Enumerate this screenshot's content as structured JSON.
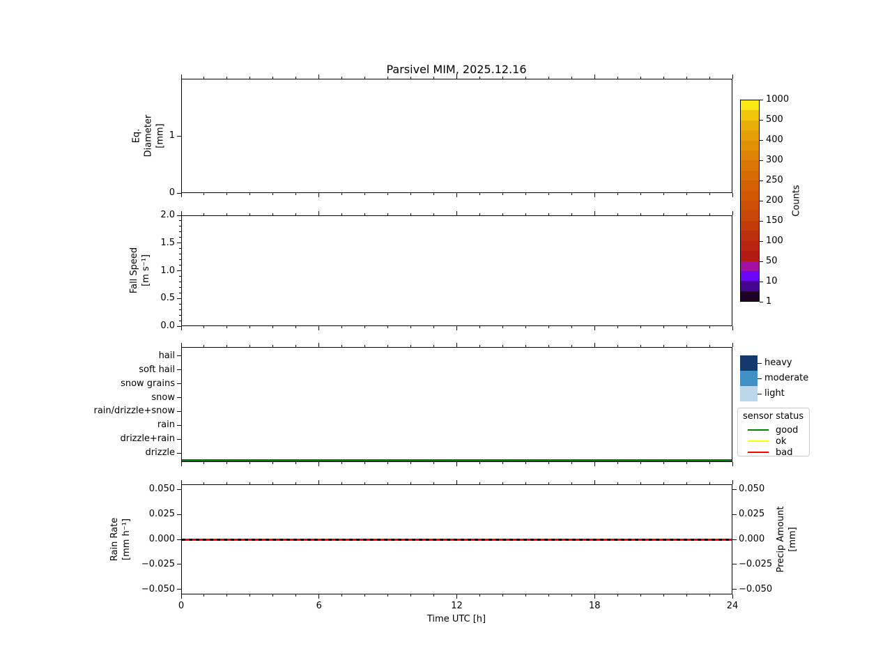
{
  "title": "Parsivel MIM, 2025.12.16",
  "xlabel": "Time UTC [h]",
  "x_axis": {
    "tick_labels": [
      "0",
      "6",
      "12",
      "18",
      "24"
    ],
    "tick_hours": [
      0,
      6,
      12,
      18,
      24
    ],
    "minor_every_hours": 1,
    "xlim": [
      0,
      24
    ]
  },
  "colorbar": {
    "label": "Counts",
    "tick_labels": [
      "1",
      "10",
      "50",
      "100",
      "150",
      "200",
      "250",
      "300",
      "400",
      "500",
      "1000"
    ],
    "colors_bottom_to_top": [
      "#1e0226",
      "#45038f",
      "#6a05f9",
      "#a311a3",
      "#b21a12",
      "#b8240f",
      "#bd300d",
      "#c23c0a",
      "#c84708",
      "#cd4f05",
      "#d25804",
      "#d66104",
      "#d96b04",
      "#db7604",
      "#de8305",
      "#e19106",
      "#e5a007",
      "#eaae08",
      "#f2c60d",
      "#fbe817"
    ]
  },
  "intensity_legend": {
    "items": [
      {
        "label": "heavy",
        "color": "#15396c"
      },
      {
        "label": "moderate",
        "color": "#4090c5"
      },
      {
        "label": "light",
        "color": "#bdd7ea"
      }
    ]
  },
  "sensor_legend": {
    "title": "sensor status",
    "items": [
      {
        "label": "good",
        "color": "#008000"
      },
      {
        "label": "ok",
        "color": "#ffff00"
      },
      {
        "label": "bad",
        "color": "#ff0000"
      }
    ]
  },
  "chart_data": [
    {
      "type": "heatmap",
      "panel": "eq_diameter",
      "title": "Parsivel MIM, 2025.12.16",
      "ylabel": "Eq.\nDiameter\n[mm]",
      "xlim": [
        0,
        24
      ],
      "ylim": [
        0,
        2
      ],
      "ytick_values": [
        0,
        1
      ],
      "ytick_labels": [
        "0",
        "1"
      ],
      "values": []
    },
    {
      "type": "heatmap",
      "panel": "fall_speed",
      "ylabel": "Fall Speed\n[m s⁻¹]",
      "xlim": [
        0,
        24
      ],
      "ylim": [
        0,
        2
      ],
      "ytick_values": [
        0,
        0.5,
        1,
        1.5,
        2
      ],
      "ytick_labels": [
        "0.0",
        "0.5",
        "1.0",
        "1.5",
        "2.0"
      ],
      "yminor_step": 0.1,
      "values": []
    },
    {
      "type": "line",
      "panel": "weather_code",
      "categories_bottom_to_top": [
        "drizzle",
        "drizzle+rain",
        "rain",
        "rain/drizzle+snow",
        "snow",
        "snow grains",
        "soft hail",
        "hail"
      ],
      "xlim": [
        0,
        24
      ],
      "ylim": [
        -0.65,
        7.65
      ],
      "series": [
        {
          "name": "sensor status good",
          "color": "#008000",
          "x": [
            0,
            24
          ],
          "y": [
            -0.5,
            -0.5
          ]
        }
      ]
    },
    {
      "type": "line",
      "panel": "rain_rate",
      "ylabel": "Rain Rate\n[mm h⁻¹]",
      "ylabel_right": "Precip Amount\n[mm]",
      "xlim": [
        0,
        24
      ],
      "ylim": [
        -0.055,
        0.055
      ],
      "ytick_values": [
        -0.05,
        -0.025,
        0,
        0.025,
        0.05
      ],
      "ytick_labels": [
        "−0.050",
        "−0.025",
        "0.000",
        "0.025",
        "0.050"
      ],
      "series": [
        {
          "name": "rain rate",
          "color": "#ff0000",
          "style": "solid",
          "x": [
            0,
            24
          ],
          "y": [
            0,
            0
          ]
        },
        {
          "name": "precip amount",
          "color": "#000000",
          "style": "dashed",
          "x": [
            0,
            24
          ],
          "y": [
            0,
            0
          ]
        }
      ]
    }
  ]
}
